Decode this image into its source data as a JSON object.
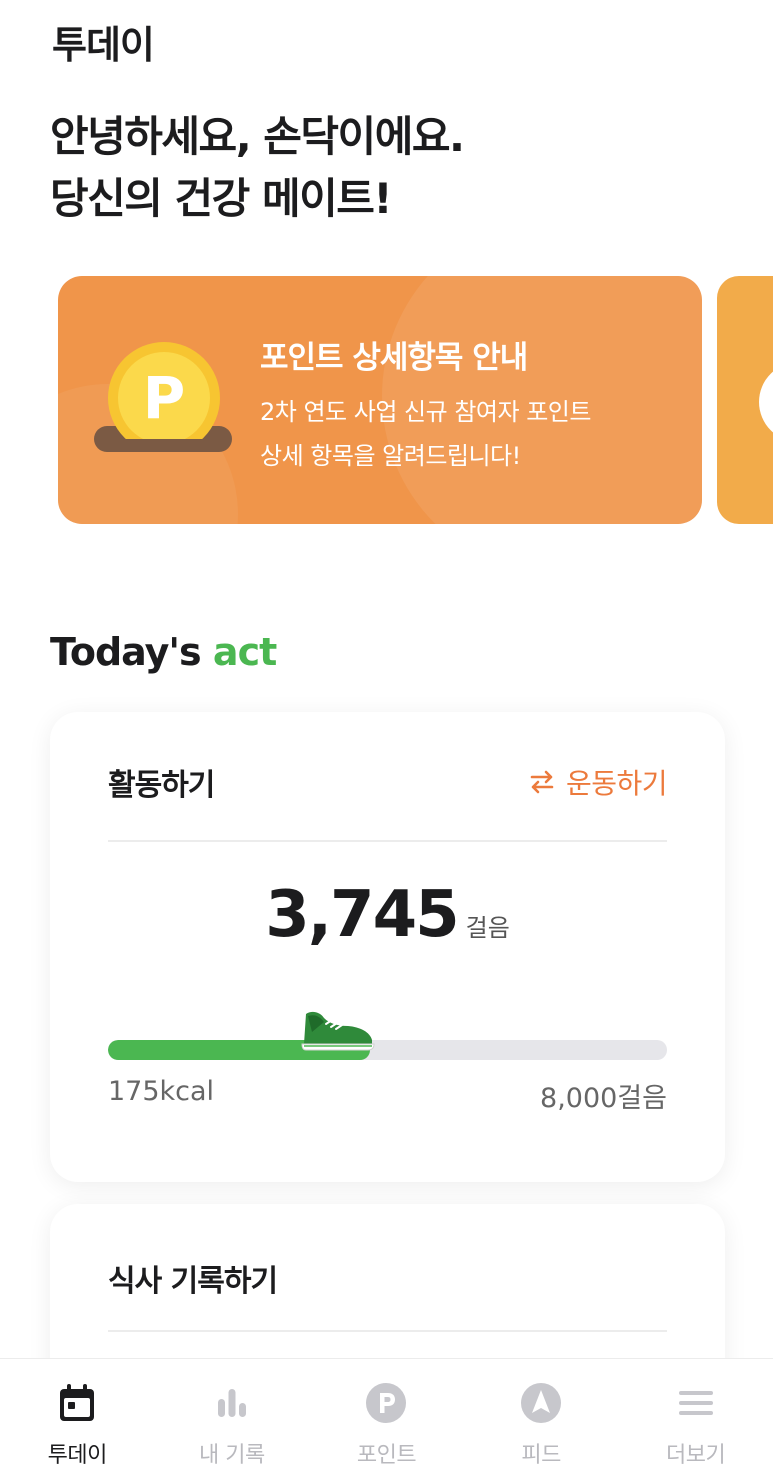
{
  "header": {
    "title": "투데이"
  },
  "greeting": {
    "line1": "안녕하세요, 손닥이에요.",
    "line2": "당신의 건강 메이트!"
  },
  "banner": {
    "coin_letter": "P",
    "title": "포인트 상세항목 안내",
    "desc_line1": "2차 연도 사업 신규 참여자 포인트",
    "desc_line2": "상세 항목을 알려드립니다!",
    "color": "#f0954a"
  },
  "section": {
    "title_main": "Today's",
    "title_accent": "act",
    "accent_color": "#4bb751"
  },
  "activity_card": {
    "title": "활동하기",
    "switch_label": "운동하기",
    "switch_icon": "swap-arrows-icon",
    "steps": "3,745",
    "steps_unit": "걸음",
    "progress": 0.468,
    "kcal": "175kcal",
    "goal": "8,000걸음"
  },
  "meal_card": {
    "title": "식사 기록하기"
  },
  "nav": {
    "items": [
      {
        "label": "투데이",
        "icon": "calendar-icon",
        "active": true
      },
      {
        "label": "내 기록",
        "icon": "bar-chart-icon",
        "active": false
      },
      {
        "label": "포인트",
        "icon": "point-icon",
        "active": false
      },
      {
        "label": "피드",
        "icon": "compass-icon",
        "active": false
      },
      {
        "label": "더보기",
        "icon": "menu-icon",
        "active": false
      }
    ]
  }
}
